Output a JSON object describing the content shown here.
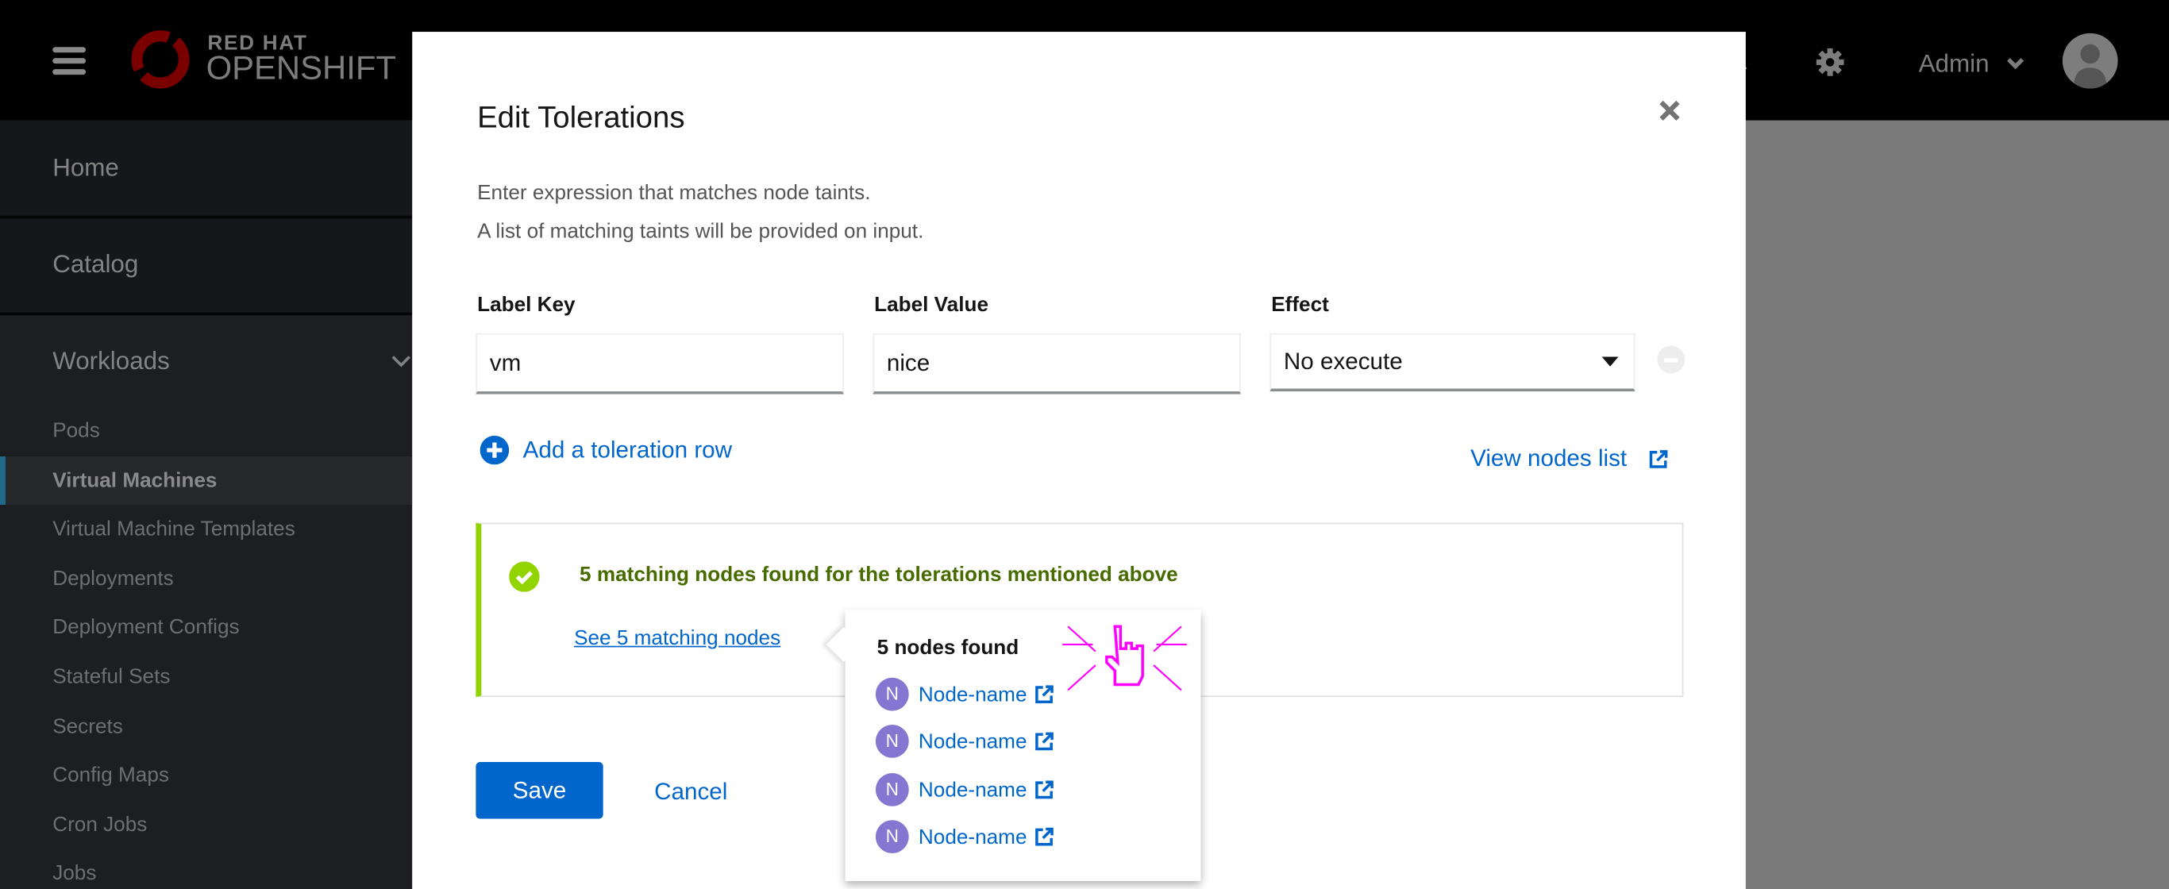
{
  "header": {
    "brand_line1": "RED HAT",
    "brand_line2": "OPENSHIFT",
    "user_label": "Admin",
    "icons": [
      "hamburger-menu-icon",
      "openshift-logo",
      "bell-icon",
      "gear-icon",
      "chevron-down-icon",
      "user-avatar-icon"
    ]
  },
  "sidebar": {
    "sections": [
      {
        "label": "Home"
      },
      {
        "label": "Catalog"
      },
      {
        "label": "Workloads",
        "expanded": true
      }
    ],
    "workload_items": [
      {
        "label": "Pods"
      },
      {
        "label": "Virtual Machines",
        "selected": true
      },
      {
        "label": "Virtual Machine Templates"
      },
      {
        "label": "Deployments"
      },
      {
        "label": "Deployment Configs"
      },
      {
        "label": "Stateful Sets"
      },
      {
        "label": "Secrets"
      },
      {
        "label": "Config Maps"
      },
      {
        "label": "Cron Jobs"
      },
      {
        "label": "Jobs"
      }
    ]
  },
  "modal": {
    "title": "Edit Tolerations",
    "description_line1": "Enter expression that matches node taints.",
    "description_line2": "A list of matching taints will be provided on input.",
    "columns": {
      "key": "Label Key",
      "value": "Label Value",
      "effect": "Effect"
    },
    "row": {
      "key": "vm",
      "value": "nice",
      "effect": "No execute"
    },
    "add_row_label": "Add a toleration row",
    "view_nodes_label": "View nodes list",
    "alert": {
      "message": "5 matching nodes found for the tolerations mentioned above",
      "link": "See 5 matching nodes",
      "status_color": "#92d400"
    },
    "popover": {
      "title": "5 nodes found",
      "nodes": [
        {
          "initial": "N",
          "name": "Node-name"
        },
        {
          "initial": "N",
          "name": "Node-name"
        },
        {
          "initial": "N",
          "name": "Node-name"
        },
        {
          "initial": "N",
          "name": "Node-name"
        }
      ]
    },
    "save_label": "Save",
    "cancel_label": "Cancel"
  },
  "colors": {
    "primary": "#0066cc",
    "success_text": "#486b00",
    "avatar": "#8476d1"
  }
}
